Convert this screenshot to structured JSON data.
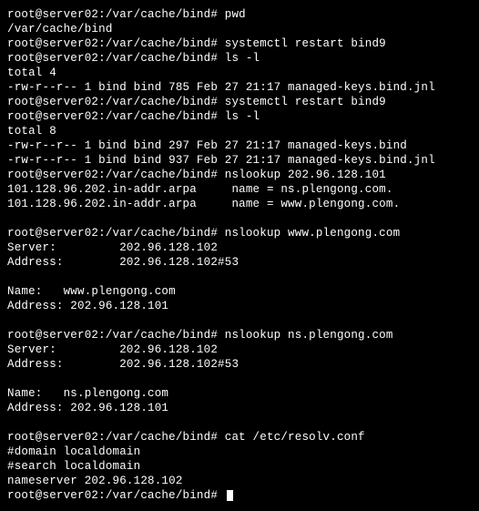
{
  "prompt_prefix": "root@server02:/var/cache/bind# ",
  "lines": [
    "root@server02:/var/cache/bind# pwd",
    "/var/cache/bind",
    "root@server02:/var/cache/bind# systemctl restart bind9",
    "root@server02:/var/cache/bind# ls -l",
    "total 4",
    "-rw-r--r-- 1 bind bind 785 Feb 27 21:17 managed-keys.bind.jnl",
    "root@server02:/var/cache/bind# systemctl restart bind9",
    "root@server02:/var/cache/bind# ls -l",
    "total 8",
    "-rw-r--r-- 1 bind bind 297 Feb 27 21:17 managed-keys.bind",
    "-rw-r--r-- 1 bind bind 937 Feb 27 21:17 managed-keys.bind.jnl",
    "root@server02:/var/cache/bind# nslookup 202.96.128.101",
    "101.128.96.202.in-addr.arpa     name = ns.plengong.com.",
    "101.128.96.202.in-addr.arpa     name = www.plengong.com.",
    "",
    "root@server02:/var/cache/bind# nslookup www.plengong.com",
    "Server:         202.96.128.102",
    "Address:        202.96.128.102#53",
    "",
    "Name:   www.plengong.com",
    "Address: 202.96.128.101",
    "",
    "root@server02:/var/cache/bind# nslookup ns.plengong.com",
    "Server:         202.96.128.102",
    "Address:        202.96.128.102#53",
    "",
    "Name:   ns.plengong.com",
    "Address: 202.96.128.101",
    "",
    "root@server02:/var/cache/bind# cat /etc/resolv.conf",
    "#domain localdomain",
    "#search localdomain",
    "nameserver 202.96.128.102",
    "root@server02:/var/cache/bind# "
  ]
}
